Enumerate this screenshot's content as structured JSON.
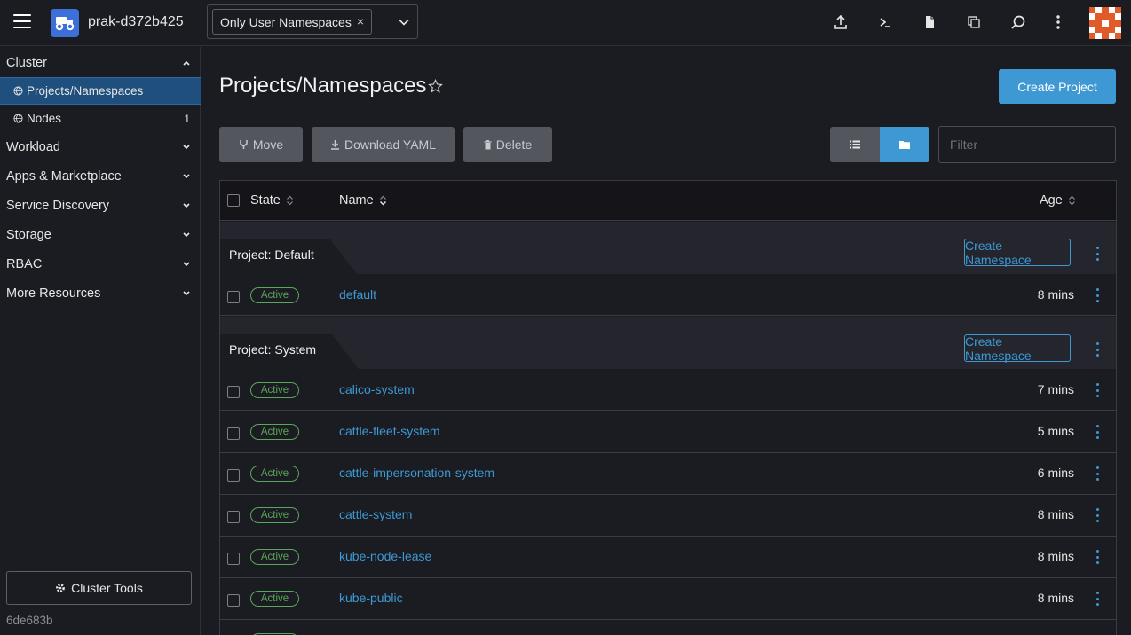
{
  "header": {
    "cluster_name": "prak-d372b425",
    "namespace_filter_chip": "Only User Namespaces",
    "chip_remove": "×",
    "avatar_colors": [
      "#e05a2a",
      "#ffffff"
    ]
  },
  "sidebar": {
    "groups": [
      {
        "label": "Cluster",
        "expanded": true
      },
      {
        "label": "Workload"
      },
      {
        "label": "Apps & Marketplace"
      },
      {
        "label": "Service Discovery"
      },
      {
        "label": "Storage"
      },
      {
        "label": "RBAC"
      },
      {
        "label": "More Resources"
      }
    ],
    "cluster_items": [
      {
        "label": "Projects/Namespaces",
        "active": true,
        "count": ""
      },
      {
        "label": "Nodes",
        "active": false,
        "count": "1"
      }
    ],
    "cluster_tools_label": "Cluster Tools",
    "version": "6de683b"
  },
  "main": {
    "title": "Projects/Namespaces",
    "create_project_label": "Create Project",
    "actions": {
      "move": "Move",
      "download_yaml": "Download YAML",
      "delete": "Delete"
    },
    "filter_placeholder": "Filter",
    "columns": {
      "state": "State",
      "name": "Name",
      "age": "Age"
    },
    "create_namespace_label": "Create Namespace",
    "groups": [
      {
        "project": "Project: Default",
        "namespaces": [
          {
            "state": "Active",
            "name": "default",
            "age": "8 mins"
          }
        ]
      },
      {
        "project": "Project: System",
        "namespaces": [
          {
            "state": "Active",
            "name": "calico-system",
            "age": "7 mins"
          },
          {
            "state": "Active",
            "name": "cattle-fleet-system",
            "age": "5 mins"
          },
          {
            "state": "Active",
            "name": "cattle-impersonation-system",
            "age": "6 mins"
          },
          {
            "state": "Active",
            "name": "cattle-system",
            "age": "8 mins"
          },
          {
            "state": "Active",
            "name": "kube-node-lease",
            "age": "8 mins"
          },
          {
            "state": "Active",
            "name": "kube-public",
            "age": "8 mins"
          }
        ]
      }
    ]
  },
  "colors": {
    "accent": "#3d98d3",
    "active_state": "#5aa65a",
    "sidebar_active": "#1f4f7d",
    "background": "#1b1c21"
  }
}
